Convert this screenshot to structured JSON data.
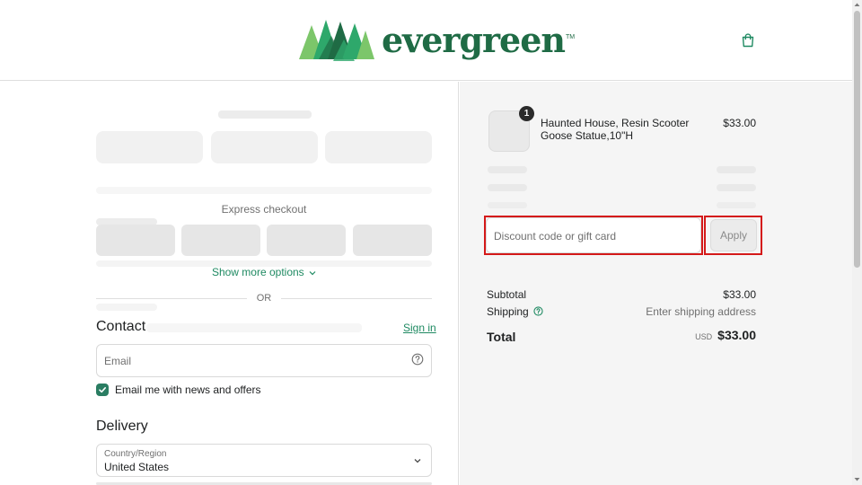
{
  "header": {
    "brand": "evergreen",
    "trademark": "TM",
    "cart_icon": "shopping-bag-icon",
    "brand_colors": {
      "dark": "#1f6b45",
      "mid": "#2ea86b",
      "light": "#7cc66a"
    }
  },
  "express": {
    "label": "Express checkout",
    "show_more": "Show more options",
    "or": "OR"
  },
  "contact": {
    "title": "Contact",
    "sign_in": "Sign in",
    "email_placeholder": "Email",
    "newsletter_label": "Email me with news and offers",
    "newsletter_checked": true
  },
  "delivery": {
    "title": "Delivery",
    "country_label": "Country/Region",
    "country_value": "United States"
  },
  "order": {
    "item": {
      "quantity": "1",
      "name": "Haunted House, Resin Scooter Goose Statue,10\"H",
      "price": "$33.00"
    },
    "discount_placeholder": "Discount code or gift card",
    "apply_label": "Apply",
    "subtotal_label": "Subtotal",
    "subtotal_value": "$33.00",
    "shipping_label": "Shipping",
    "shipping_value": "Enter shipping address",
    "total_label": "Total",
    "currency": "USD",
    "total_value": "$33.00"
  },
  "colors": {
    "accent": "#1f8a62",
    "highlight": "#d41919"
  }
}
